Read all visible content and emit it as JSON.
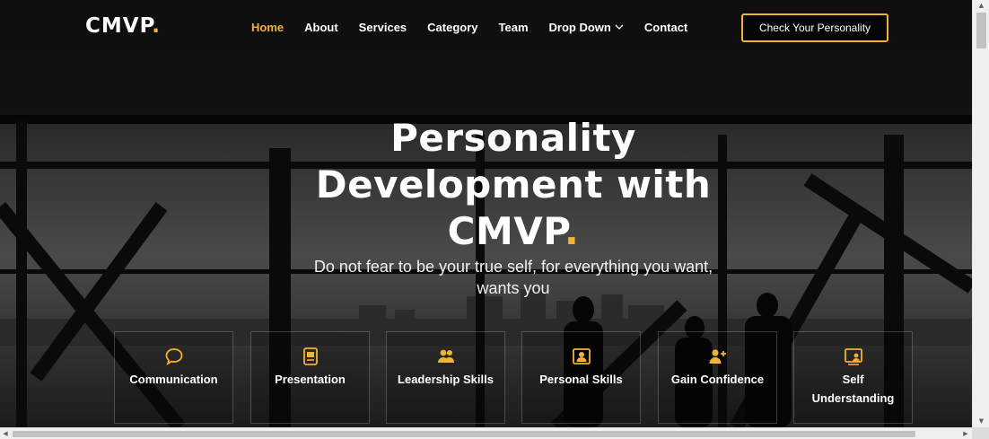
{
  "header": {
    "logo_text": "CMVP",
    "logo_dot": ".",
    "nav": [
      {
        "label": "Home",
        "active": true
      },
      {
        "label": "About"
      },
      {
        "label": "Services"
      },
      {
        "label": "Category"
      },
      {
        "label": "Team"
      },
      {
        "label": "Drop Down",
        "dropdown": true
      },
      {
        "label": "Contact"
      }
    ],
    "cta_label": "Check Your Personality"
  },
  "hero": {
    "title_line1": "Personality",
    "title_line2": "Development with",
    "title_line3": "CMVP",
    "title_dot": ".",
    "subtitle": "Do not fear to be your true self, for everything you want, wants you"
  },
  "cards": [
    {
      "label": "Communication",
      "icon": "chat-bubble-icon"
    },
    {
      "label": "Presentation",
      "icon": "presentation-icon"
    },
    {
      "label": "Leadership Skills",
      "icon": "people-icon"
    },
    {
      "label": "Personal Skills",
      "icon": "person-frame-icon"
    },
    {
      "label": "Gain Confidence",
      "icon": "add-user-icon"
    },
    {
      "label": "Self Understanding",
      "icon": "person-screen-icon"
    }
  ],
  "colors": {
    "accent": "#f2b233",
    "text": "#ffffff",
    "background": "#1a1a1a"
  }
}
